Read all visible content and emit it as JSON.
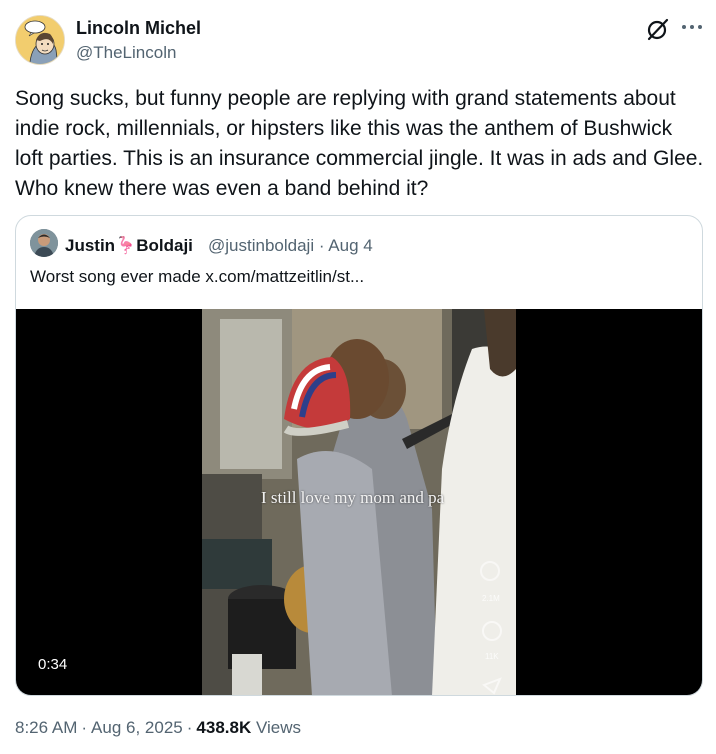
{
  "author": {
    "name": "Lincoln Michel",
    "handle": "@TheLincoln"
  },
  "tweet": {
    "text": "Song sucks, but funny people are replying with grand statements about indie rock, millennials, or hipsters like this was the anthem of Bushwick loft parties. This is an insurance commercial jingle. It was in ads and Glee. Who knew there was even a band behind it?"
  },
  "quote": {
    "name_first": "Justin",
    "emoji": "🦩",
    "name_last": "Boldaji",
    "handle": "@justinboldaji",
    "sep": "·",
    "date": "Aug 4",
    "text": "Worst song ever made  x.com/mattzeitlin/st...",
    "video": {
      "caption": "I still love my mom and pa",
      "overlay_count_1": "2.1M",
      "overlay_count_2": "11K",
      "duration": "0:34"
    }
  },
  "meta": {
    "time": "8:26 AM",
    "sep1": "·",
    "date": "Aug 6, 2025",
    "sep2": "·",
    "views_count": "438.8K",
    "views_label": "Views"
  },
  "icons": {
    "grok": "grok-icon",
    "more": "more-icon"
  },
  "colors": {
    "text_primary": "#0f1419",
    "text_secondary": "#536471",
    "border": "#cfd9de"
  }
}
